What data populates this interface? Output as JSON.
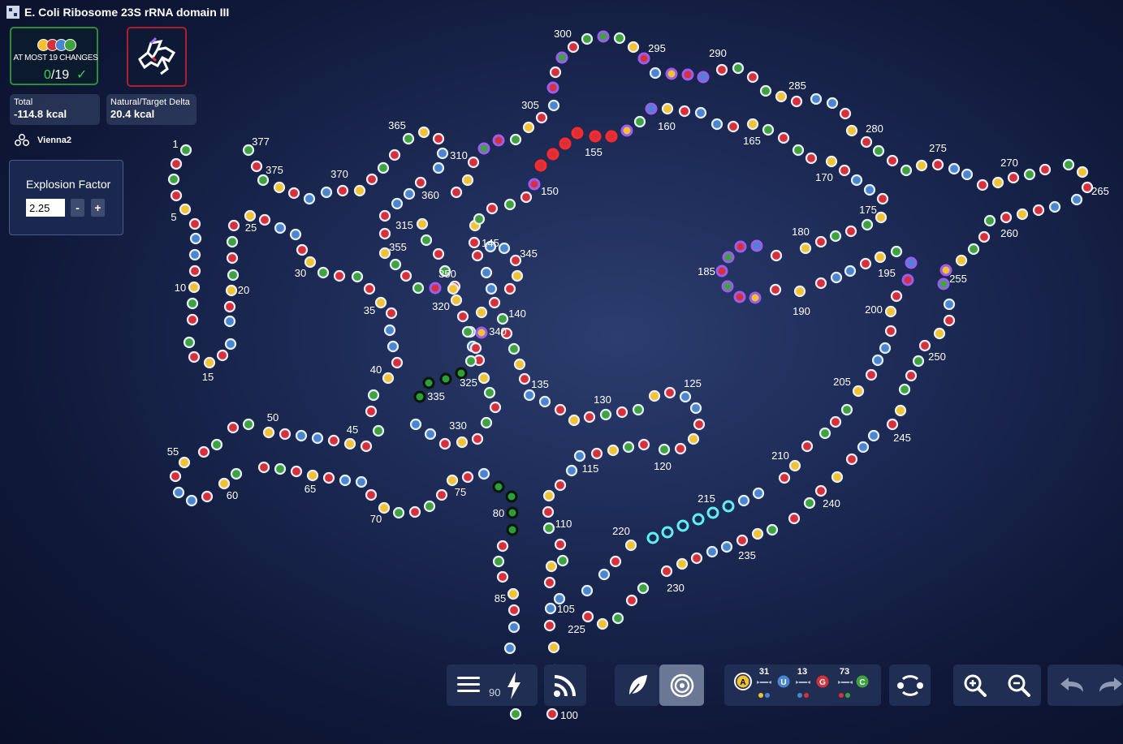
{
  "window": {
    "title": "E. Coli Ribosome 23S rRNA domain III"
  },
  "constraint": {
    "label": "AT MOST 19 CHANGES",
    "current": "0",
    "max": "/19",
    "pill_colors": [
      "#f2c230",
      "#d8303a",
      "#4a85d0",
      "#3ea33f"
    ]
  },
  "energy": {
    "total_label": "Total",
    "total_value": "-114.8 kcal",
    "delta_label": "Natural/Target Delta",
    "delta_value": "20.4 kcal"
  },
  "engine": {
    "name": "Vienna2",
    "icon": "molecule-icon"
  },
  "explosion": {
    "label": "Explosion Factor",
    "value": "2.25",
    "minus": "-",
    "plus": "+"
  },
  "toolbar": {
    "menu_icon": "hamburger-icon",
    "hint_number": "90",
    "boost_icon": "lightning-icon",
    "broadcast_icon": "rss-icon",
    "natural_mode_icon": "leaf-icon",
    "target_mode_icon": "target-icon",
    "pair_counts": {
      "au": "31",
      "gu": "13",
      "gc": "73"
    },
    "letters": {
      "a": "A",
      "u": "U",
      "g": "G",
      "c": "C"
    },
    "swap_icon": "swap-pairs-icon",
    "zoom_in_icon": "zoom-in-icon",
    "zoom_out_icon": "zoom-out-icon",
    "undo_icon": "undo-icon",
    "redo_icon": "redo-icon"
  },
  "base_colors": {
    "A": "#f2c230",
    "U": "#4a85d0",
    "G": "#d8303a",
    "C": "#3ea33f",
    "locked": "#8a3fd6"
  },
  "structure_labels": [
    "1",
    "5",
    "10",
    "15",
    "20",
    "25",
    "30",
    "35",
    "40",
    "45",
    "50",
    "55",
    "60",
    "65",
    "70",
    "75",
    "80",
    "85",
    "90",
    "100",
    "105",
    "110",
    "115",
    "120",
    "125",
    "130",
    "135",
    "140",
    "145",
    "150",
    "155",
    "160",
    "165",
    "170",
    "175",
    "180",
    "185",
    "190",
    "195",
    "200",
    "205",
    "210",
    "215",
    "220",
    "225",
    "230",
    "235",
    "240",
    "245",
    "250",
    "255",
    "260",
    "265",
    "270",
    "275",
    "280",
    "285",
    "290",
    "295",
    "300",
    "305",
    "310",
    "315",
    "320",
    "325",
    "330",
    "335",
    "340",
    "345",
    "350",
    "355",
    "360",
    "365",
    "370",
    "375",
    "377"
  ]
}
